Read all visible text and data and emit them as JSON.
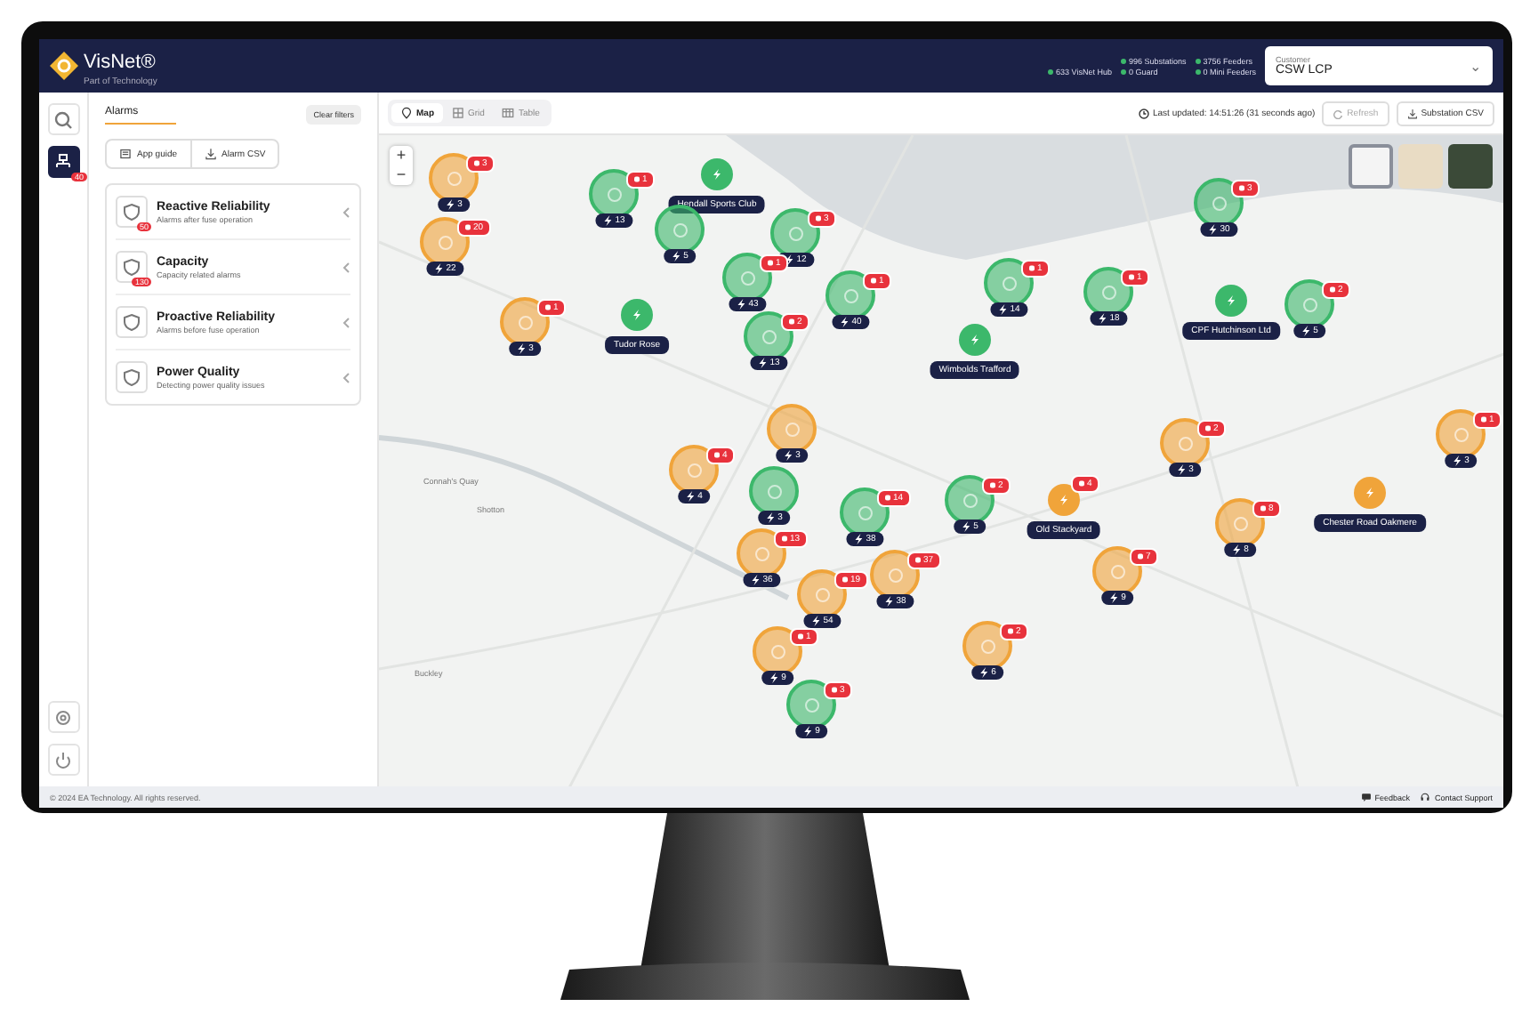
{
  "header": {
    "brand": "VisNet®",
    "tagline": "Part of Technology",
    "stats": [
      {
        "label": "996 Substations"
      },
      {
        "label": "3756 Feeders"
      },
      {
        "label": "633 VisNet Hub"
      },
      {
        "label": "0 Guard"
      },
      {
        "label": "0 Mini Feeders"
      }
    ],
    "customer": {
      "label": "Customer",
      "value": "CSW LCP",
      "caret": "⌄"
    }
  },
  "rail": [
    {
      "kind": "search",
      "selected": false
    },
    {
      "kind": "alarms",
      "selected": true,
      "badge": "40"
    }
  ],
  "rail_bottom": [
    {
      "kind": "settings"
    },
    {
      "kind": "power"
    }
  ],
  "panel": {
    "tab": "Alarms",
    "clear": "Clear filters",
    "buttons": [
      {
        "kind": "guide",
        "label": "App guide"
      },
      {
        "kind": "download",
        "label": "Alarm CSV"
      }
    ],
    "categories": [
      {
        "title": "Reactive Reliability",
        "subtitle": "Alarms after fuse operation",
        "badge": "50"
      },
      {
        "title": "Capacity",
        "subtitle": "Capacity related alarms",
        "badge": "130"
      },
      {
        "title": "Proactive Reliability",
        "subtitle": "Alarms before fuse operation"
      },
      {
        "title": "Power Quality",
        "subtitle": "Detecting power quality issues"
      }
    ]
  },
  "toolbar": {
    "views": [
      {
        "kind": "map",
        "label": "Map",
        "selected": true
      },
      {
        "kind": "grid",
        "label": "Grid",
        "selected": false
      },
      {
        "kind": "table",
        "label": "Table",
        "selected": false
      }
    ],
    "last_updated": "Last updated: 14:51:26 (31 seconds ago)",
    "refresh": {
      "label": "Refresh",
      "disabled": true
    },
    "csv": "Substation CSV"
  },
  "map": {
    "zoom": [
      "+",
      "−"
    ],
    "layers": [
      {
        "kind": "street",
        "selected": true
      },
      {
        "kind": "terrain",
        "selected": false
      },
      {
        "kind": "satellite",
        "selected": false
      }
    ],
    "places": [
      "Connah's Quay",
      "Shotton",
      "Buckley"
    ],
    "markers": [
      {
        "kind": "cluster",
        "color": "#f0a43a",
        "alarms": "3",
        "count": "3"
      },
      {
        "kind": "cluster",
        "color": "#3cb86b",
        "alarms": "1",
        "count": "13"
      },
      {
        "kind": "site",
        "color": "#3cb86b",
        "label": "Hendall Sports Club"
      },
      {
        "kind": "cluster",
        "color": "#3cb86b",
        "alarms": "3",
        "count": "30"
      },
      {
        "kind": "cluster",
        "color": "#f0a43a",
        "alarms": "20",
        "count": "22"
      },
      {
        "kind": "cluster",
        "color": "#3cb86b",
        "count": "5"
      },
      {
        "kind": "cluster",
        "color": "#3cb86b",
        "alarms": "3",
        "count": "12"
      },
      {
        "kind": "cluster",
        "color": "#3cb86b",
        "alarms": "1",
        "count": "43"
      },
      {
        "kind": "cluster",
        "color": "#3cb86b",
        "alarms": "1",
        "count": "40"
      },
      {
        "kind": "cluster",
        "color": "#3cb86b",
        "alarms": "1",
        "count": "14"
      },
      {
        "kind": "cluster",
        "color": "#3cb86b",
        "alarms": "1",
        "count": "18"
      },
      {
        "kind": "site",
        "color": "#3cb86b",
        "label": "CPF Hutchinson Ltd"
      },
      {
        "kind": "cluster",
        "color": "#3cb86b",
        "alarms": "2",
        "count": "5"
      },
      {
        "kind": "cluster",
        "color": "#f0a43a",
        "alarms": "1",
        "count": "3"
      },
      {
        "kind": "site",
        "color": "#3cb86b",
        "label": "Tudor Rose"
      },
      {
        "kind": "cluster",
        "color": "#3cb86b",
        "alarms": "2",
        "count": "13"
      },
      {
        "kind": "site",
        "color": "#3cb86b",
        "label": "Wimbolds Trafford"
      },
      {
        "kind": "cluster",
        "color": "#f0a43a",
        "alarms": "4",
        "count": "4"
      },
      {
        "kind": "cluster",
        "color": "#f0a43a",
        "count": "3"
      },
      {
        "kind": "cluster",
        "color": "#f0a43a",
        "alarms": "2",
        "count": "3"
      },
      {
        "kind": "cluster",
        "color": "#f0a43a",
        "alarms": "1",
        "count": "3"
      },
      {
        "kind": "cluster",
        "color": "#3cb86b",
        "count": "3"
      },
      {
        "kind": "cluster",
        "color": "#3cb86b",
        "alarms": "14",
        "count": "38"
      },
      {
        "kind": "cluster",
        "color": "#3cb86b",
        "alarms": "2",
        "count": "5"
      },
      {
        "kind": "site",
        "color": "#f0a43a",
        "alarms": "4",
        "label": "Old Stackyard"
      },
      {
        "kind": "cluster",
        "color": "#f0a43a",
        "alarms": "8",
        "count": "8"
      },
      {
        "kind": "site",
        "color": "#f0a43a",
        "label": "Chester Road Oakmere"
      },
      {
        "kind": "cluster",
        "color": "#f0a43a",
        "alarms": "13",
        "count": "36"
      },
      {
        "kind": "cluster",
        "color": "#f0a43a",
        "alarms": "19",
        "count": "54"
      },
      {
        "kind": "cluster",
        "color": "#f0a43a",
        "alarms": "37",
        "count": "38"
      },
      {
        "kind": "cluster",
        "color": "#f0a43a",
        "alarms": "7",
        "count": "9"
      },
      {
        "kind": "cluster",
        "color": "#f0a43a",
        "alarms": "1",
        "count": "9"
      },
      {
        "kind": "cluster",
        "color": "#f0a43a",
        "alarms": "2",
        "count": "6"
      },
      {
        "kind": "cluster",
        "color": "#3cb86b",
        "alarms": "3",
        "count": "9"
      }
    ]
  },
  "footer": {
    "copyright": "© 2024 EA Technology. All rights reserved.",
    "links": [
      {
        "kind": "feedback",
        "label": "Feedback"
      },
      {
        "kind": "support",
        "label": "Contact Support"
      }
    ]
  }
}
